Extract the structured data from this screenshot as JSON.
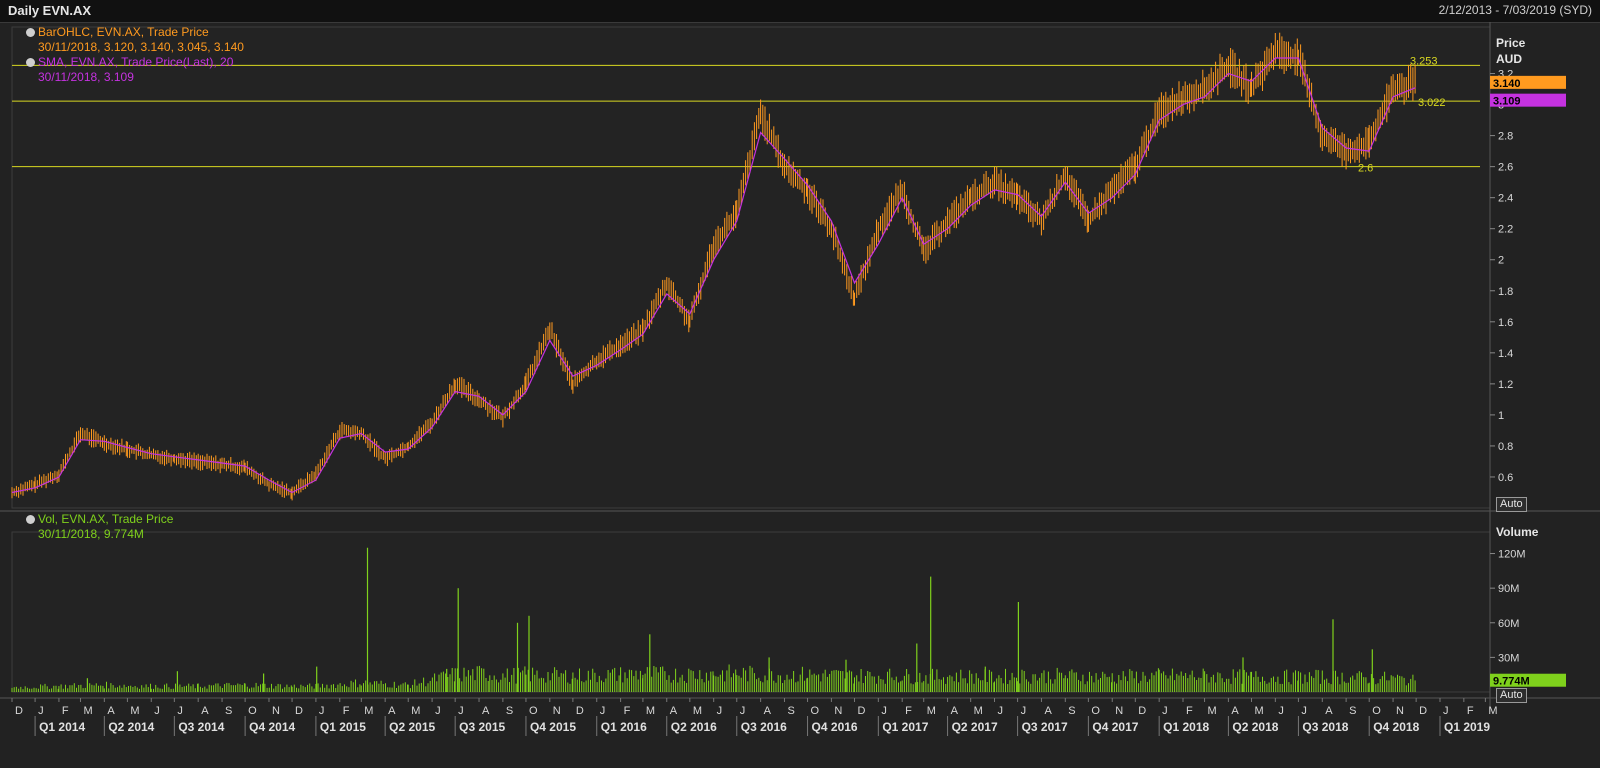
{
  "window": {
    "title": "Daily EVN.AX",
    "date_range": "2/12/2013 - 7/03/2019 (SYD)"
  },
  "legend": {
    "ohlc_name": "BarOHLC, EVN.AX, Trade Price",
    "ohlc_values": "30/11/2018, 3.120, 3.140, 3.045, 3.140",
    "sma_name": "SMA, EVN.AX, Trade Price(Last),  20",
    "sma_values": "30/11/2018, 3.109",
    "vol_name": "Vol, EVN.AX, Trade Price",
    "vol_values": "30/11/2018, 9.774M"
  },
  "axis": {
    "price_title": "Price",
    "price_unit": "AUD",
    "volume_title": "Volume",
    "auto_label": "Auto"
  },
  "colors": {
    "bars": "#ff9a1f",
    "sma": "#c532e0",
    "volume": "#7fd11c",
    "hlines": "#d8d821",
    "background": "#222222",
    "grid": "#3a3a3a"
  },
  "chart_data": [
    {
      "type": "line",
      "title": "Daily EVN.AX",
      "ylabel": "Price AUD",
      "ylim": [
        0.4,
        3.5
      ],
      "yticks": [
        "0.6",
        "0.8",
        "1",
        "1.2",
        "1.4",
        "1.6",
        "1.8",
        "2",
        "2.2",
        "2.4",
        "2.6",
        "2.8",
        "3",
        "3.2"
      ],
      "last_price_badge": "3.140",
      "last_sma_badge": "3.109",
      "horizontal_lines": [
        {
          "value": 3.253,
          "label": "3.253"
        },
        {
          "value": 3.022,
          "label": "3.022"
        },
        {
          "value": 2.6,
          "label": "2.6"
        }
      ],
      "series": [
        {
          "name": "BarOHLC, EVN.AX, Trade Price",
          "style": "ohlc",
          "x": [
            "2013-12-02",
            "2014-01-01",
            "2014-02-01",
            "2014-03-01",
            "2014-04-01",
            "2014-05-01",
            "2014-06-01",
            "2014-07-01",
            "2014-08-01",
            "2014-09-01",
            "2014-10-01",
            "2014-11-01",
            "2014-12-01",
            "2015-01-01",
            "2015-02-01",
            "2015-03-01",
            "2015-04-01",
            "2015-05-01",
            "2015-06-01",
            "2015-07-01",
            "2015-08-01",
            "2015-09-01",
            "2015-10-01",
            "2015-11-01",
            "2015-12-01",
            "2016-01-01",
            "2016-02-01",
            "2016-03-01",
            "2016-04-01",
            "2016-05-01",
            "2016-06-01",
            "2016-07-01",
            "2016-08-01",
            "2016-09-01",
            "2016-10-01",
            "2016-11-01",
            "2016-12-01",
            "2017-01-01",
            "2017-02-01",
            "2017-03-01",
            "2017-04-01",
            "2017-05-01",
            "2017-06-01",
            "2017-07-01",
            "2017-08-01",
            "2017-09-01",
            "2017-10-01",
            "2017-11-01",
            "2017-12-01",
            "2018-01-01",
            "2018-02-01",
            "2018-03-01",
            "2018-04-01",
            "2018-05-01",
            "2018-06-01",
            "2018-07-01",
            "2018-08-01",
            "2018-09-01",
            "2018-10-01",
            "2018-11-01",
            "2018-11-30"
          ],
          "y": [
            0.5,
            0.55,
            0.62,
            0.88,
            0.82,
            0.78,
            0.74,
            0.72,
            0.7,
            0.68,
            0.66,
            0.55,
            0.5,
            0.62,
            0.9,
            0.88,
            0.72,
            0.8,
            0.95,
            1.2,
            1.1,
            0.98,
            1.2,
            1.55,
            1.2,
            1.35,
            1.45,
            1.55,
            1.85,
            1.6,
            2.1,
            2.3,
            2.95,
            2.6,
            2.45,
            2.2,
            1.75,
            2.2,
            2.45,
            2.05,
            2.25,
            2.4,
            2.5,
            2.4,
            2.25,
            2.55,
            2.25,
            2.45,
            2.6,
            2.95,
            3.05,
            3.1,
            3.25,
            3.1,
            3.35,
            3.3,
            2.8,
            2.7,
            2.75,
            3.1,
            3.14
          ]
        },
        {
          "name": "SMA, EVN.AX, Trade Price(Last),  20",
          "style": "line",
          "x": [
            "2013-12-02",
            "2014-01-01",
            "2014-02-01",
            "2014-03-01",
            "2014-04-01",
            "2014-05-01",
            "2014-06-01",
            "2014-07-01",
            "2014-08-01",
            "2014-09-01",
            "2014-10-01",
            "2014-11-01",
            "2014-12-01",
            "2015-01-01",
            "2015-02-01",
            "2015-03-01",
            "2015-04-01",
            "2015-05-01",
            "2015-06-01",
            "2015-07-01",
            "2015-08-01",
            "2015-09-01",
            "2015-10-01",
            "2015-11-01",
            "2015-12-01",
            "2016-01-01",
            "2016-02-01",
            "2016-03-01",
            "2016-04-01",
            "2016-05-01",
            "2016-06-01",
            "2016-07-01",
            "2016-08-01",
            "2016-09-01",
            "2016-10-01",
            "2016-11-01",
            "2016-12-01",
            "2017-01-01",
            "2017-02-01",
            "2017-03-01",
            "2017-04-01",
            "2017-05-01",
            "2017-06-01",
            "2017-07-01",
            "2017-08-01",
            "2017-09-01",
            "2017-10-01",
            "2017-11-01",
            "2017-12-01",
            "2018-01-01",
            "2018-02-01",
            "2018-03-01",
            "2018-04-01",
            "2018-05-01",
            "2018-06-01",
            "2018-07-01",
            "2018-08-01",
            "2018-09-01",
            "2018-10-01",
            "2018-11-01",
            "2018-11-30"
          ],
          "y": [
            0.5,
            0.53,
            0.6,
            0.84,
            0.83,
            0.79,
            0.75,
            0.73,
            0.71,
            0.69,
            0.67,
            0.58,
            0.5,
            0.58,
            0.85,
            0.88,
            0.76,
            0.78,
            0.92,
            1.15,
            1.12,
            1.0,
            1.15,
            1.48,
            1.25,
            1.32,
            1.42,
            1.52,
            1.78,
            1.65,
            2.0,
            2.25,
            2.82,
            2.65,
            2.48,
            2.25,
            1.85,
            2.1,
            2.4,
            2.1,
            2.2,
            2.35,
            2.45,
            2.42,
            2.28,
            2.5,
            2.3,
            2.4,
            2.55,
            2.9,
            3.0,
            3.05,
            3.2,
            3.15,
            3.3,
            3.3,
            2.85,
            2.72,
            2.7,
            3.05,
            3.109
          ]
        }
      ]
    },
    {
      "type": "bar",
      "title": "Vol, EVN.AX, Trade Price",
      "ylabel": "Volume",
      "ylim": [
        0,
        130000000
      ],
      "yticks": [
        "30M",
        "60M",
        "90M",
        "120M"
      ],
      "last_volume_badge": "9.774M",
      "series": [
        {
          "name": "Vol, EVN.AX, Trade Price",
          "x": [
            "2013-12-02",
            "2014-02-01",
            "2014-04-01",
            "2014-06-01",
            "2014-08-01",
            "2014-10-01",
            "2014-12-01",
            "2015-01-01",
            "2015-03-01",
            "2015-05-01",
            "2015-07-01",
            "2015-08-15",
            "2015-09-01",
            "2015-10-01",
            "2015-12-01",
            "2016-02-01",
            "2016-03-01",
            "2016-04-01",
            "2016-06-01",
            "2016-07-01",
            "2016-08-01",
            "2016-10-01",
            "2016-12-01",
            "2017-02-01",
            "2017-03-01",
            "2017-04-01",
            "2017-06-01",
            "2017-07-01",
            "2017-09-01",
            "2017-11-01",
            "2018-01-01",
            "2018-03-01",
            "2018-05-01",
            "2018-07-01",
            "2018-08-01",
            "2018-09-01",
            "2018-10-01",
            "2018-11-01",
            "2018-11-30"
          ],
          "values": [
            4000000,
            5000000,
            6000000,
            5000000,
            5000000,
            6000000,
            5000000,
            5000000,
            8000000,
            6000000,
            15000000,
            16000000,
            14000000,
            15000000,
            14000000,
            15000000,
            16000000,
            15000000,
            16000000,
            16000000,
            15000000,
            15000000,
            14000000,
            14000000,
            13000000,
            14000000,
            13000000,
            14000000,
            14000000,
            13000000,
            14000000,
            14000000,
            13000000,
            13000000,
            13000000,
            13000000,
            12000000,
            12000000,
            9774000
          ]
        },
        {
          "name": "spikes",
          "x": [
            "2014-03-10",
            "2014-07-05",
            "2014-10-25",
            "2015-01-02",
            "2015-03-09",
            "2015-06-20",
            "2015-07-05",
            "2015-09-20",
            "2015-10-05",
            "2016-03-10",
            "2016-08-12",
            "2016-11-20",
            "2017-02-20",
            "2017-03-10",
            "2017-05-20",
            "2017-07-02",
            "2018-04-20",
            "2018-08-15",
            "2018-10-05"
          ],
          "values": [
            12000000,
            18000000,
            16000000,
            22000000,
            125000000,
            20000000,
            90000000,
            60000000,
            66000000,
            50000000,
            30000000,
            28000000,
            42000000,
            100000000,
            22000000,
            78000000,
            30000000,
            63000000,
            37000000
          ]
        }
      ]
    }
  ],
  "xaxis": {
    "months": [
      "D",
      "J",
      "F",
      "M",
      "A",
      "M",
      "J",
      "J",
      "A",
      "S",
      "O",
      "N",
      "D",
      "J",
      "F",
      "M",
      "A",
      "M",
      "J",
      "J",
      "A",
      "S",
      "O",
      "N",
      "D",
      "J",
      "F",
      "M",
      "A",
      "M",
      "J",
      "J",
      "A",
      "S",
      "O",
      "N",
      "D",
      "J",
      "F",
      "M",
      "A",
      "M",
      "J",
      "J",
      "A",
      "S",
      "O",
      "N",
      "D",
      "J",
      "F",
      "M",
      "A",
      "M",
      "J",
      "J",
      "A",
      "S",
      "O",
      "N",
      "D",
      "J",
      "F",
      "M"
    ],
    "quarters": [
      "Q1 2014",
      "Q2 2014",
      "Q3 2014",
      "Q4 2014",
      "Q1 2015",
      "Q2 2015",
      "Q3 2015",
      "Q4 2015",
      "Q1 2016",
      "Q2 2016",
      "Q3 2016",
      "Q4 2016",
      "Q1 2017",
      "Q2 2017",
      "Q3 2017",
      "Q4 2017",
      "Q1 2018",
      "Q2 2018",
      "Q3 2018",
      "Q4 2018",
      "Q1 2019"
    ]
  }
}
